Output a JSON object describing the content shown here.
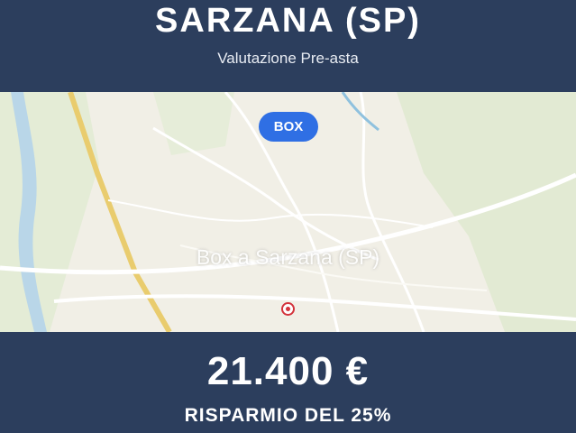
{
  "header": {
    "title": "SARZANA (SP)",
    "subtitle": "Valutazione Pre-asta"
  },
  "map": {
    "badge": "BOX",
    "overlay_title": "Box a Sarzana (SP)",
    "marker_icon": "location-marker-icon"
  },
  "footer": {
    "price": "21.400 €",
    "savings": "RISPARMIO DEL 25%"
  },
  "colors": {
    "banner": "#2c3e5d",
    "badge": "#2f6fe4",
    "marker": "#d3333b"
  }
}
